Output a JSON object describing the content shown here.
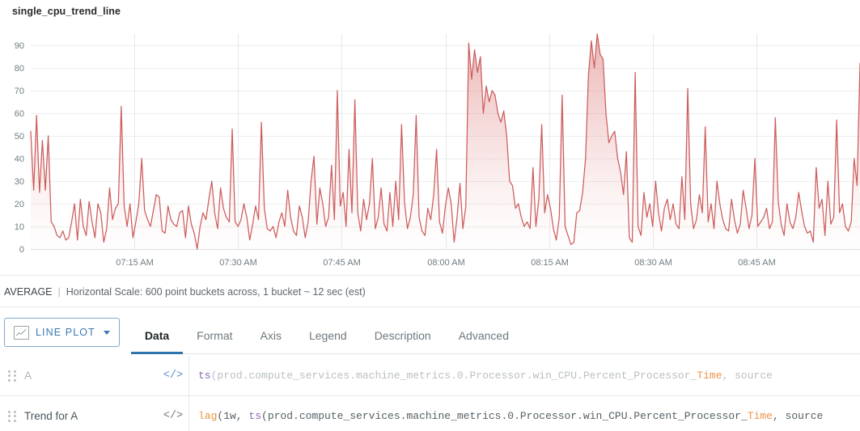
{
  "chart": {
    "title": "single_cpu_trend_line",
    "caption": {
      "aggregation": "AVERAGE",
      "separator": "|",
      "scale_text": "Horizontal Scale: 600 point buckets across, 1 bucket ~ 12 sec (est)"
    }
  },
  "chart_data": {
    "type": "line",
    "title": "single_cpu_trend_line",
    "xlabel": "",
    "ylabel": "",
    "ylim": [
      0,
      95
    ],
    "yticks": [
      0,
      10,
      20,
      30,
      40,
      50,
      60,
      70,
      80,
      90
    ],
    "xticks": [
      "07:15 AM",
      "07:30 AM",
      "07:45 AM",
      "08:00 AM",
      "08:15 AM",
      "08:30 AM",
      "08:45 AM"
    ],
    "grid": true,
    "legend": false,
    "line_color": "#cd5c5c",
    "fill_color": "#e8a0a0",
    "series": [
      {
        "name": "A",
        "values": [
          52,
          26,
          59,
          25,
          48,
          26,
          50,
          12,
          10,
          6,
          5,
          8,
          4,
          5,
          12,
          20,
          4,
          22,
          10,
          6,
          21,
          12,
          5,
          20,
          16,
          3,
          9,
          27,
          13,
          18,
          20,
          63,
          19,
          10,
          20,
          5,
          12,
          20,
          40,
          17,
          13,
          10,
          17,
          24,
          23,
          8,
          7,
          19,
          13,
          11,
          10,
          16,
          17,
          5,
          19,
          11,
          7,
          0,
          10,
          16,
          13,
          22,
          30,
          16,
          9,
          27,
          18,
          14,
          12,
          53,
          12,
          10,
          13,
          20,
          14,
          4,
          11,
          19,
          13,
          56,
          18,
          9,
          8,
          10,
          5,
          12,
          16,
          10,
          26,
          14,
          8,
          6,
          19,
          14,
          5,
          12,
          30,
          41,
          11,
          27,
          20,
          10,
          14,
          37,
          13,
          70,
          19,
          25,
          10,
          44,
          16,
          66,
          16,
          8,
          22,
          13,
          20,
          40,
          9,
          14,
          27,
          11,
          8,
          25,
          10,
          30,
          13,
          55,
          21,
          9,
          14,
          24,
          59,
          14,
          8,
          6,
          18,
          13,
          24,
          44,
          12,
          7,
          19,
          27,
          20,
          3,
          14,
          29,
          9,
          19,
          91,
          75,
          88,
          78,
          85,
          60,
          72,
          65,
          70,
          68,
          60,
          56,
          61,
          50,
          30,
          28,
          18,
          20,
          14,
          10,
          12,
          9,
          36,
          10,
          22,
          55,
          16,
          24,
          18,
          9,
          4,
          14,
          68,
          10,
          6,
          2,
          3,
          16,
          17,
          25,
          40,
          77,
          92,
          80,
          95,
          86,
          84,
          60,
          47,
          50,
          52,
          40,
          34,
          24,
          43,
          5,
          3,
          78,
          10,
          6,
          25,
          14,
          20,
          10,
          30,
          16,
          8,
          18,
          22,
          13,
          20,
          11,
          9,
          32,
          13,
          71,
          20,
          9,
          13,
          24,
          16,
          54,
          12,
          20,
          9,
          30,
          20,
          13,
          9,
          8,
          22,
          13,
          7,
          11,
          26,
          18,
          9,
          15,
          40,
          10,
          12,
          14,
          18,
          9,
          12,
          58,
          21,
          11,
          6,
          20,
          12,
          9,
          14,
          25,
          17,
          10,
          7,
          8,
          3,
          36,
          18,
          22,
          6,
          30,
          11,
          14,
          57,
          16,
          20,
          10,
          8,
          12,
          40,
          28,
          82
        ]
      }
    ]
  },
  "toolbar": {
    "plot_type": "LINE PLOT",
    "tabs": [
      {
        "label": "Data",
        "active": true
      },
      {
        "label": "Format",
        "active": false
      },
      {
        "label": "Axis",
        "active": false
      },
      {
        "label": "Legend",
        "active": false
      },
      {
        "label": "Description",
        "active": false
      },
      {
        "label": "Advanced",
        "active": false
      }
    ]
  },
  "expressions": [
    {
      "name_placeholder": "A",
      "name_value": "",
      "code_icon": "</>",
      "code_tokens": [
        {
          "text": "ts",
          "style": "fn-purple"
        },
        {
          "text": "(prod.compute_services.machine_metrics.0.Processor.win_CPU.Percent_Processor_",
          "style": "dim"
        },
        {
          "text": "Time",
          "style": "hl"
        },
        {
          "text": ", source",
          "style": "dim"
        }
      ]
    },
    {
      "name_placeholder": "",
      "name_value": "Trend for A",
      "code_icon": "</>",
      "code_tokens": [
        {
          "text": "lag",
          "style": "fn-orange"
        },
        {
          "text": "(1w, ",
          "style": "plain"
        },
        {
          "text": "ts",
          "style": "fn-purple"
        },
        {
          "text": "(prod.compute_services.machine_metrics.0.Processor.win_CPU.Percent_Processor_",
          "style": "plain"
        },
        {
          "text": "Time",
          "style": "hl"
        },
        {
          "text": ", source",
          "style": "plain"
        }
      ]
    }
  ],
  "colors": {
    "accent_blue": "#3a78b5",
    "tab_active_underline": "#2f73ab",
    "series_line": "#cd5c5c",
    "series_fill": "#e8a0a0",
    "grid": "#ebedee"
  }
}
